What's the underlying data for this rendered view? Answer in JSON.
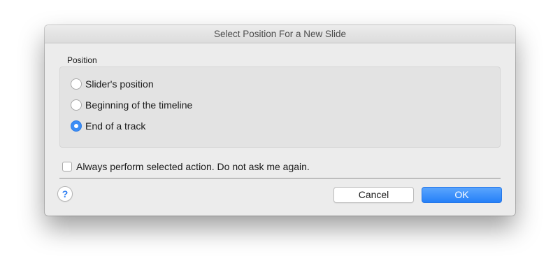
{
  "dialog": {
    "title": "Select Position For a New Slide",
    "group_label": "Position",
    "options": [
      {
        "label": "Slider's position",
        "selected": false
      },
      {
        "label": "Beginning of the timeline",
        "selected": false
      },
      {
        "label": "End of a track",
        "selected": true
      }
    ],
    "always_perform_label": "Always perform selected action. Do not ask me again.",
    "always_perform_checked": false,
    "help_label": "?",
    "cancel_label": "Cancel",
    "ok_label": "OK"
  },
  "colors": {
    "accent": "#2f7ff2",
    "dialog_bg": "#ececec",
    "group_bg": "#e3e3e3"
  }
}
